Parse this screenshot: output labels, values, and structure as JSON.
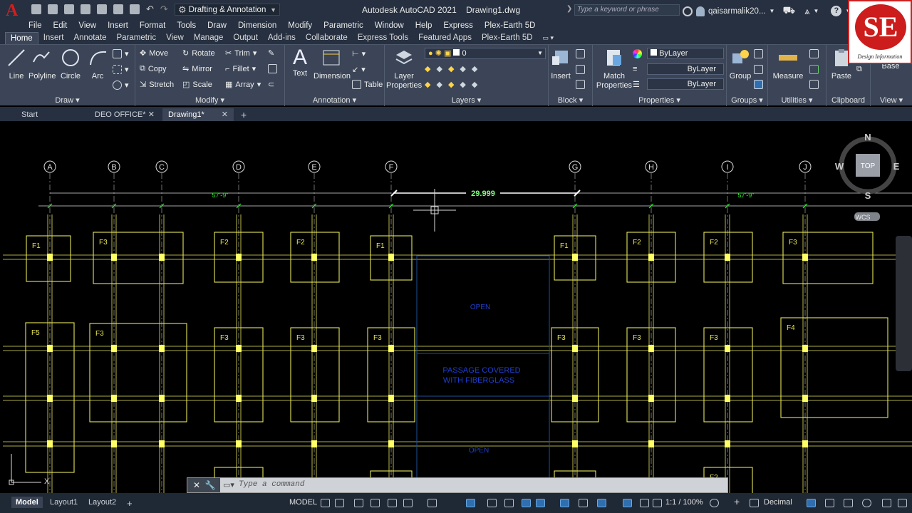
{
  "app": {
    "title": "Autodesk AutoCAD 2021",
    "file_name": "Drawing1.dwg",
    "workspace": "Drafting & Annotation",
    "search_placeholder": "Type a keyword or phrase",
    "user": "qaisarmalik20..."
  },
  "menus": [
    "File",
    "Edit",
    "View",
    "Insert",
    "Format",
    "Tools",
    "Draw",
    "Dimension",
    "Modify",
    "Parametric",
    "Window",
    "Help",
    "Express",
    "Plex-Earth 5D"
  ],
  "ribbon_tabs": [
    "Home",
    "Insert",
    "Annotate",
    "Parametric",
    "View",
    "Manage",
    "Output",
    "Add-ins",
    "Collaborate",
    "Express Tools",
    "Featured Apps",
    "Plex-Earth 5D"
  ],
  "ribbon": {
    "draw": {
      "title": "Draw",
      "line": "Line",
      "polyline": "Polyline",
      "circle": "Circle",
      "arc": "Arc"
    },
    "modify": {
      "title": "Modify",
      "move": "Move",
      "rotate": "Rotate",
      "trim": "Trim",
      "copy": "Copy",
      "mirror": "Mirror",
      "fillet": "Fillet",
      "stretch": "Stretch",
      "scale": "Scale",
      "array": "Array"
    },
    "annotation": {
      "title": "Annotation",
      "text": "Text",
      "dimension": "Dimension",
      "table": "Table"
    },
    "layers": {
      "title": "Layers",
      "layer_properties": "Layer\nProperties",
      "current_layer": "0"
    },
    "block": {
      "title": "Block",
      "insert": "Insert"
    },
    "properties": {
      "title": "Properties",
      "match": "Match\nProperties",
      "color": "ByLayer",
      "linetype": "ByLayer",
      "lineweight": "ByLayer"
    },
    "groups": {
      "title": "Groups",
      "group": "Group"
    },
    "utilities": {
      "title": "Utilities",
      "measure": "Measure"
    },
    "clipboard": {
      "title": "Clipboard",
      "paste": "Paste"
    },
    "view": {
      "title": "View",
      "base": "Base"
    }
  },
  "file_tabs": [
    "Start",
    "DEO OFFICE*",
    "Drawing1*"
  ],
  "drawing": {
    "grid_labels": [
      "A",
      "B",
      "C",
      "D",
      "E",
      "F",
      "G",
      "H",
      "I",
      "J"
    ],
    "dimension_value": "29.999",
    "dim_57_left": "57'-9\"",
    "dim_57_right": "57'-9\"",
    "passage_text_1": "PASSAGE COVERED",
    "passage_text_2": "WITH FIBERGLASS",
    "open_label_top": "OPEN",
    "open_label_bottom": "OPEN",
    "compass": {
      "n": "N",
      "s": "S",
      "e": "E",
      "w": "W",
      "top": "TOP"
    },
    "wcs": "WCS"
  },
  "command_line": {
    "placeholder": "Type a command"
  },
  "status": {
    "layout_tabs": [
      "Model",
      "Layout1",
      "Layout2"
    ],
    "model": "MODEL",
    "scale": "1:1 / 100%",
    "units": "Decimal"
  },
  "logo": {
    "letters": "SE",
    "caption": "Design Information"
  }
}
